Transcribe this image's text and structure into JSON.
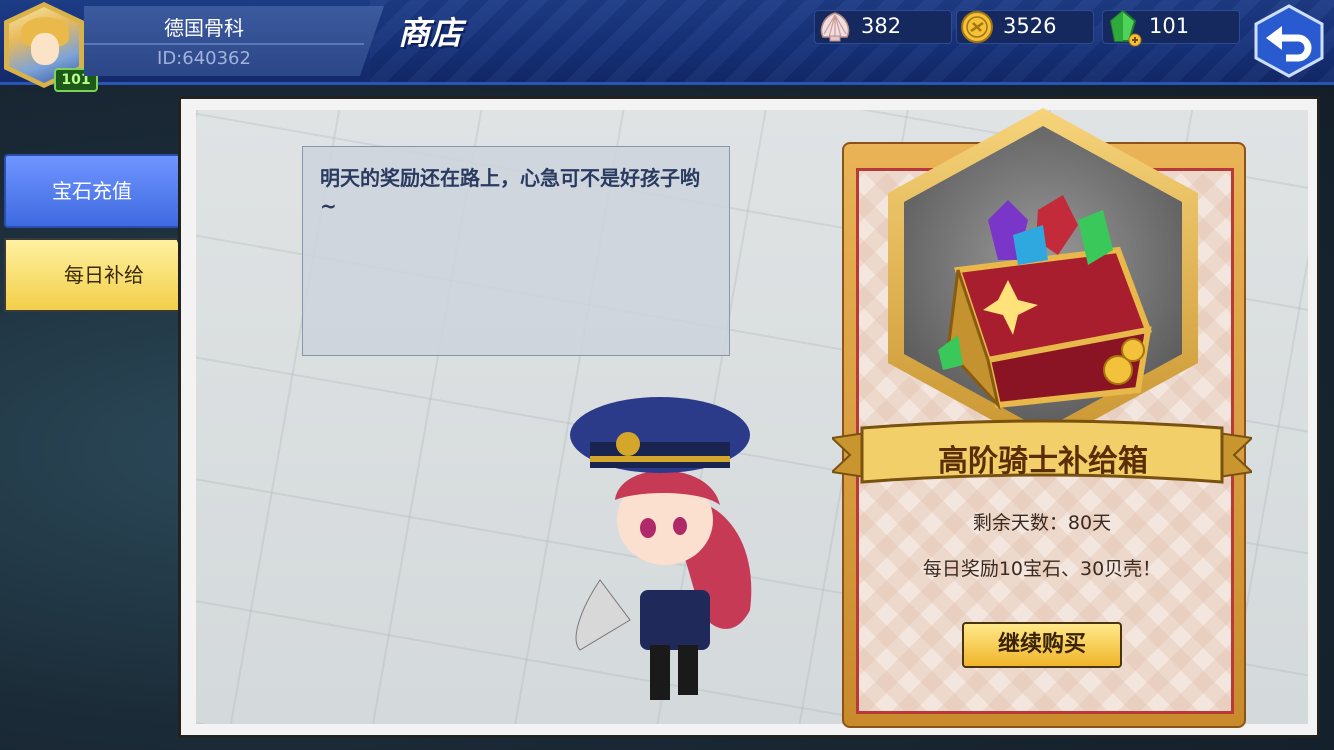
{
  "player": {
    "name": "德国骨科",
    "id": "ID:640362",
    "level": "101"
  },
  "header": {
    "title": "商店"
  },
  "currencies": [
    {
      "icon": "shell-icon",
      "value": "382"
    },
    {
      "icon": "gold-coin-icon",
      "value": "3526"
    },
    {
      "icon": "green-gem-icon",
      "value": "101"
    }
  ],
  "sidebar": {
    "tabs": [
      {
        "label": "宝石充值"
      },
      {
        "label": "每日补给"
      }
    ]
  },
  "dialog": {
    "text": "明天的奖励还在路上，心急可不是好孩子哟~"
  },
  "card": {
    "title": "高阶骑士补给箱",
    "remaining": "剩余天数：80天",
    "reward": "每日奖励10宝石、30贝壳！",
    "button": "继续购买"
  },
  "colors": {
    "topbar": "#1d3c86",
    "tab_active": "#f2cf4a",
    "tab_inactive": "#3f6ae0",
    "card_border": "#b83a38"
  }
}
